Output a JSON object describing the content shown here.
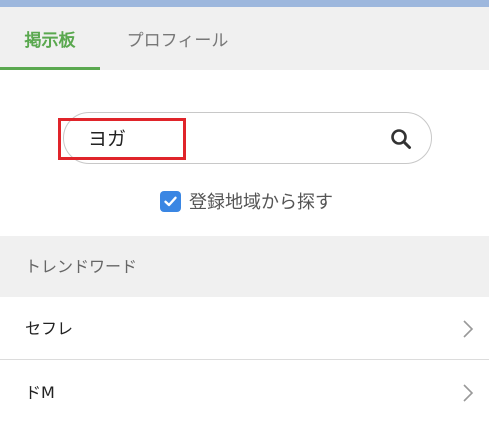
{
  "tabs": {
    "board_label": "掲示板",
    "profile_label": "プロフィール"
  },
  "search": {
    "value": "ヨガ",
    "icon": "search-icon"
  },
  "region_filter": {
    "label": "登録地域から探す",
    "checked": true
  },
  "trend": {
    "title": "トレンドワード",
    "items": [
      {
        "label": "セフレ"
      },
      {
        "label": "ドM"
      }
    ]
  },
  "colors": {
    "accent_green": "#5aa84f",
    "checkbox_blue": "#3a86e3",
    "highlight_red": "#e0242a",
    "top_strip": "#9db7dd"
  }
}
